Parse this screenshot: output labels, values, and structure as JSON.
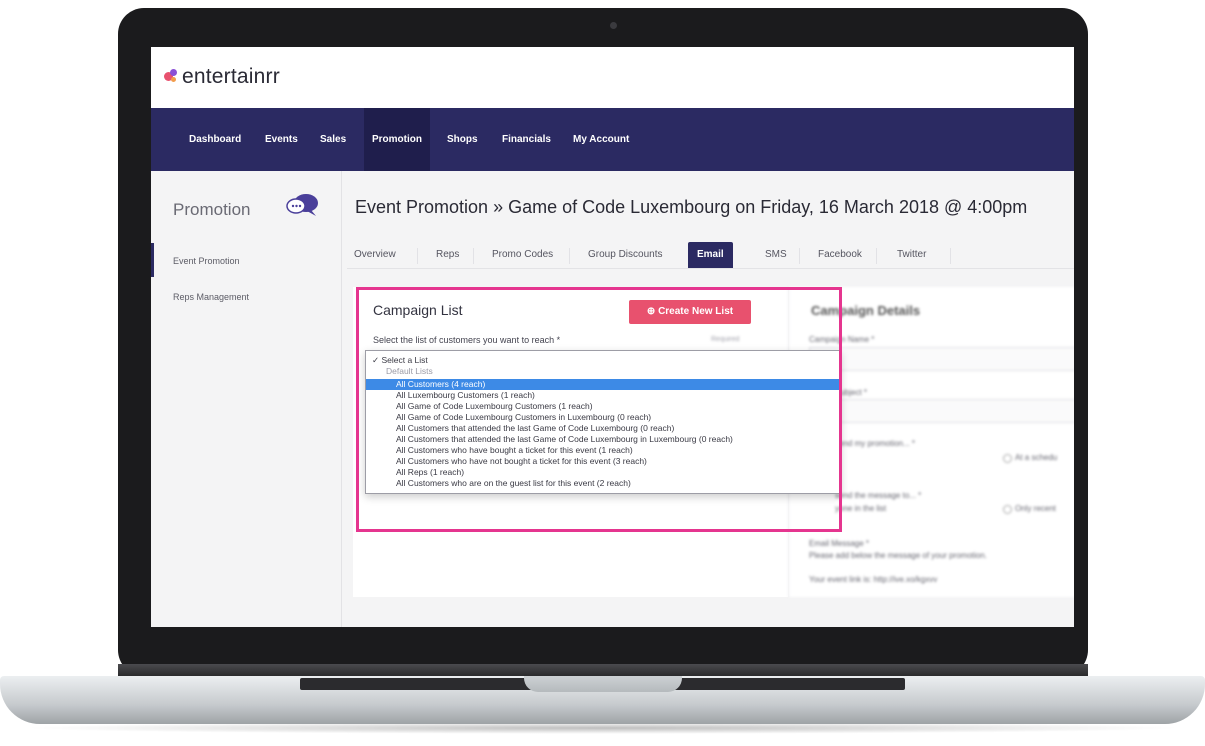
{
  "brand": {
    "name": "entertainrr",
    "colors": {
      "primary": "#2b2a62",
      "accent": "#e8516e",
      "highlight": "#e5358f",
      "select": "#3d8ae6"
    }
  },
  "nav": {
    "items": [
      "Dashboard",
      "Events",
      "Sales",
      "Promotion",
      "Shops",
      "Financials",
      "My Account"
    ],
    "active": "Promotion"
  },
  "sidebar": {
    "title": "Promotion",
    "icon": "chat-bubbles-icon",
    "items": [
      "Event Promotion",
      "Reps Management"
    ]
  },
  "page": {
    "title": "Event Promotion » Game of Code Luxembourg on Friday, 16 March 2018 @ 4:00pm"
  },
  "tabs": {
    "items": [
      "Overview",
      "Reps",
      "Promo Codes",
      "Group Discounts",
      "Email",
      "SMS",
      "Facebook",
      "Twitter"
    ],
    "active": "Email"
  },
  "campaign": {
    "title": "Campaign List",
    "create_label": "Create New List",
    "select_label": "Select the list of customers you want to reach *",
    "required_hint": "Required",
    "dropdown": {
      "selected": "✓ Select a List",
      "group": "Default Lists",
      "options": [
        "All Customers (4 reach)",
        "All Luxembourg Customers (1 reach)",
        "All Game of Code Luxembourg Customers (1 reach)",
        "All Game of Code Luxembourg Customers in Luxembourg (0 reach)",
        "All Customers that attended the last Game of Code Luxembourg (0 reach)",
        "All Customers that attended the last Game of Code Luxembourg in Luxembourg (0 reach)",
        "All Customers who have bought a ticket for this event (1 reach)",
        "All Customers who have not bought a ticket for this event (3 reach)",
        "All Reps (1 reach)",
        "All Customers who are on the guest list for this event (2 reach)"
      ],
      "highlighted": "All Customers (4 reach)"
    }
  },
  "details": {
    "title": "Campaign Details",
    "campaign_name": "Campaign Name *",
    "subject": "Subject *",
    "send_promotion": "send my promotion... *",
    "at_schedule": "At a schedu",
    "send_message": "send the message to... *",
    "everyone": "yone in the list",
    "only_recent": "Only recent",
    "email_message": "Email Message *",
    "email_hint": "Please add below the message of your promotion.",
    "event_link": "Your event link is: http://ive.xo/kgxvv"
  }
}
